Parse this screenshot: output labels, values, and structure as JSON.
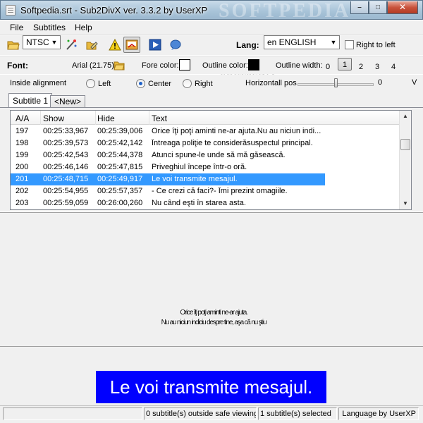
{
  "window": {
    "title": "Softpedia.srt - Sub2DivX ver. 3.3.2 by UserXP",
    "minimize_glyph": "–",
    "maximize_glyph": "□",
    "close_glyph": "✕"
  },
  "watermark": "SOFTPEDIA",
  "watermark_small": "SOFTPEDIA",
  "menu": {
    "file": "File",
    "subtitles": "Subtitles",
    "help": "Help"
  },
  "toolbar": {
    "framerate_value": "NTSC",
    "lang_label": "Lang:",
    "lang_value": "en ENGLISH",
    "rtl_label": "Right to left",
    "rtl_checked": false
  },
  "fontbar": {
    "font_label": "Font:",
    "font_value": "Arial (21.75)",
    "fore_color_label": "Fore color:",
    "fore_color": "#ffffff",
    "outline_color_label": "Outline color:",
    "outline_color": "#000000",
    "outline_width_label": "Outline width:",
    "outline_widths": [
      "0",
      "1",
      "2",
      "3",
      "4"
    ],
    "outline_width_selected": "1"
  },
  "alignbar": {
    "inside_label": "Inside alignment",
    "left": "Left",
    "center": "Center",
    "right": "Right",
    "selected": "Center",
    "hpos_label": "Horizontall pos",
    "hpos_value": "0",
    "vpos_label": "V",
    "hpos_fraction": 0.5
  },
  "tabs": [
    {
      "label": "Subtitle 1",
      "active": true
    },
    {
      "label": "<New>",
      "active": false
    }
  ],
  "list": {
    "columns": {
      "aa": "A/A",
      "show": "Show",
      "hide": "Hide",
      "text": "Text"
    },
    "rows": [
      {
        "aa": "197",
        "show": "00:25:33,967",
        "hide": "00:25:39,006",
        "text": "Orice îţi poţi aminti ne-ar ajuta.Nu au niciun indi..."
      },
      {
        "aa": "198",
        "show": "00:25:39,573",
        "hide": "00:25:42,142",
        "text": "Întreaga poliţie te considerăsuspectul principal."
      },
      {
        "aa": "199",
        "show": "00:25:42,543",
        "hide": "00:25:44,378",
        "text": "Atunci spune-le unde să mă găsească."
      },
      {
        "aa": "200",
        "show": "00:25:46,146",
        "hide": "00:25:47,815",
        "text": "Priveghiul începe într-o oră."
      },
      {
        "aa": "201",
        "show": "00:25:48,715",
        "hide": "00:25:49,917",
        "text": "Le voi transmite mesajul."
      },
      {
        "aa": "202",
        "show": "00:25:54,955",
        "hide": "00:25:57,357",
        "text": "- Ce crezi că faci?- Îmi prezint omagiile."
      },
      {
        "aa": "203",
        "show": "00:25:59,059",
        "hide": "00:26:00,260",
        "text": "Nu când eşti în starea asta."
      }
    ],
    "selected_index": 4
  },
  "preview": {
    "line1": "Orice îţi poţi aminti ne-ar ajuta.",
    "line2": "Nu au niciun indiciu despre tine, aşa că nu ştiu"
  },
  "subtitle_display": "Le voi transmite mesajul.",
  "status": {
    "cell1": "",
    "outside": "0 subtitle(s) outside safe viewing",
    "selected": "1 subtitle(s) selected",
    "language_by": "Language by UserXP"
  },
  "colors": {
    "selection": "#3399ff",
    "subtitle_bg": "#0000ff",
    "subtitle_fg": "#ffffff"
  }
}
